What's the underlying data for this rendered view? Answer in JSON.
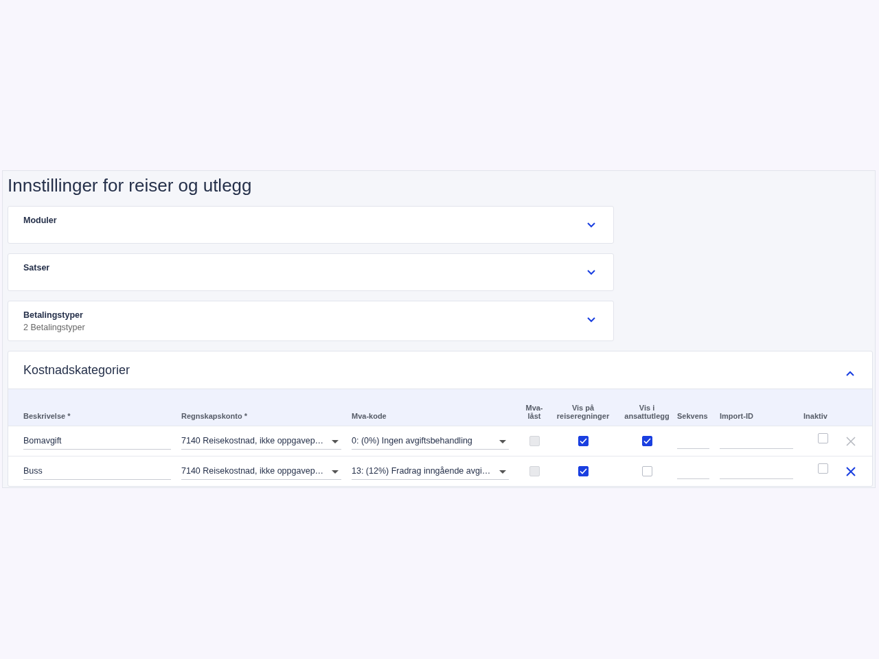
{
  "page": {
    "title": "Innstillinger for reiser og utlegg"
  },
  "sections": [
    {
      "title": "Moduler",
      "expanded": false
    },
    {
      "title": "Satser",
      "expanded": false
    },
    {
      "title": "Betalingstyper",
      "subtitle": "2 Betalingstyper",
      "expanded": false
    }
  ],
  "cost_categories": {
    "title": "Kostnadskategorier",
    "expanded": true,
    "columns": [
      "Beskrivelse *",
      "Regnskapskonto *",
      "Mva-kode",
      "Mva-låst",
      "Vis på reiseregninger",
      "Vis i ansattutlegg",
      "Sekvens",
      "Import-ID",
      "Inaktiv"
    ],
    "rows": [
      {
        "description": "Bomavgift",
        "account": "7140 Reisekostnad, ikke oppgavep…",
        "vat_code": "0: (0%) Ingen avgiftsbehandling",
        "vat_locked": false,
        "show_travel": true,
        "show_expense": true,
        "inactive": false,
        "deletable": false
      },
      {
        "description": "Buss",
        "account": "7140 Reisekostnad, ikke oppgavep…",
        "vat_code": "13: (12%) Fradrag inngående avgi…",
        "vat_locked": false,
        "show_travel": true,
        "show_expense": false,
        "inactive": false,
        "deletable": true
      }
    ]
  }
}
